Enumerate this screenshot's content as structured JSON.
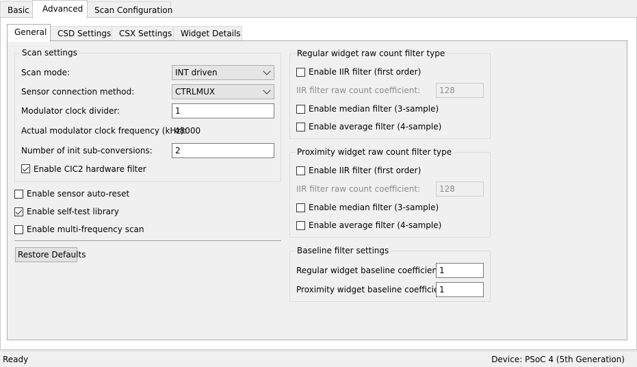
{
  "top_tabs": [
    "Basic",
    "Advanced",
    "Scan Configuration"
  ],
  "sub_tabs": [
    "General",
    "CSD Settings",
    "CSX Settings",
    "Widget Details"
  ],
  "scan_settings": {
    "title": "Scan settings",
    "scan_mode_label": "Scan mode:",
    "scan_mode_value": "INT driven",
    "sensor_conn_label": "Sensor connection method:",
    "sensor_conn_value": "CTRLMUX",
    "mod_clk_div_label": "Modulator clock divider:",
    "mod_clk_div_value": "1",
    "actual_freq_label": "Actual modulator clock frequency (kHz):",
    "actual_freq_value": "48000",
    "init_subconv_label": "Number of init sub-conversions:",
    "init_subconv_value": "2",
    "cic2_label": "Enable CIC2 hardware filter",
    "cic2_checked": true
  },
  "options": {
    "auto_reset_label": "Enable sensor auto-reset",
    "auto_reset_checked": false,
    "self_test_label": "Enable self-test library",
    "self_test_checked": true,
    "multi_freq_label": "Enable multi-frequency scan",
    "multi_freq_checked": false
  },
  "restore_label": "Restore Defaults",
  "regular_filter": {
    "title": "Regular widget raw count filter type",
    "iir_label": "Enable IIR filter (first order)",
    "iir_coef_label": "IIR filter raw count coefficient:",
    "iir_coef_value": "128",
    "median_label": "Enable median filter (3-sample)",
    "average_label": "Enable average filter (4-sample)"
  },
  "proximity_filter": {
    "title": "Proximity widget raw count filter type",
    "iir_label": "Enable IIR filter (first order)",
    "iir_coef_label": "IIR filter raw count coefficient:",
    "iir_coef_value": "128",
    "median_label": "Enable median filter (3-sample)",
    "average_label": "Enable average filter (4-sample)"
  },
  "baseline": {
    "title": "Baseline filter settings",
    "regular_label": "Regular widget baseline coefficient:",
    "regular_value": "1",
    "proximity_label": "Proximity widget baseline coefficient:",
    "proximity_value": "1"
  },
  "status": {
    "left": "Ready",
    "right": "Device: PSoC 4 (5th Generation)"
  }
}
